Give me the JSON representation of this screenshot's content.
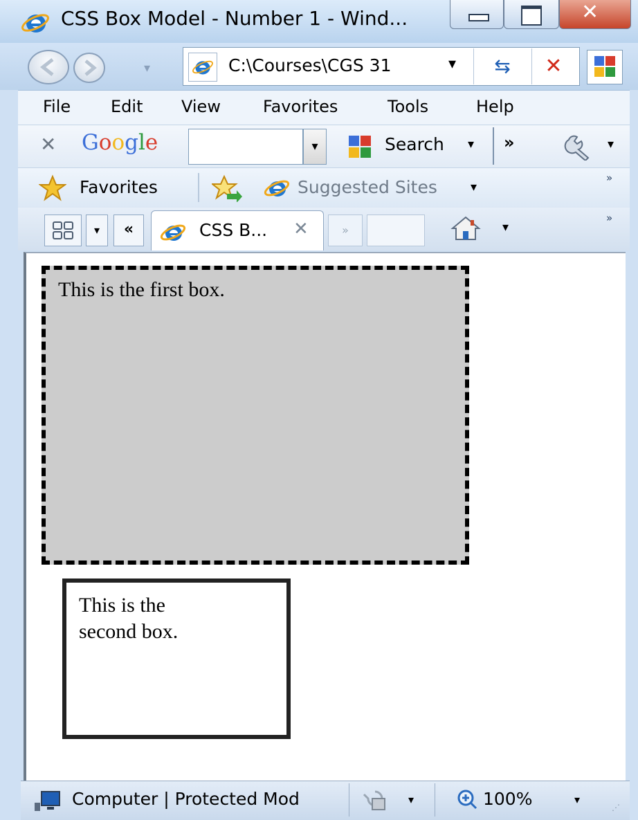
{
  "window": {
    "title": "CSS Box Model - Number 1 - Wind...",
    "close_glyph": "✕"
  },
  "nav": {
    "address": "C:\\Courses\\CGS 31",
    "dropdown_glyph": "▾",
    "refresh_glyph": "⇆",
    "stop_glyph": "✕"
  },
  "menu": {
    "items": [
      "File",
      "Edit",
      "View",
      "Favorites",
      "Tools",
      "Help"
    ]
  },
  "google_toolbar": {
    "close_glyph": "✕",
    "logo_letters": [
      "G",
      "o",
      "o",
      "g",
      "l",
      "e"
    ],
    "search_value": "",
    "search_label": "Search",
    "more_glyph": "»",
    "dd_glyph": "▾"
  },
  "favorites_bar": {
    "favorites_label": "Favorites",
    "suggested_sites_label": "Suggested Sites",
    "overflow_glyph": "»"
  },
  "tabs": {
    "scroll_left_glyph": "«",
    "scroll_right_glyph": "»",
    "active_tab_label": "CSS B...",
    "close_glyph": "✕",
    "overflow_glyph": "»"
  },
  "page": {
    "box1_text": "This is the first box.",
    "box2_text": "This is the second box."
  },
  "status": {
    "zone_text": "Computer | Protected Mod",
    "zoom": "100%"
  },
  "colors": {
    "box1_background": "#cccccc",
    "box_border": "#000000",
    "chrome_blue": "#cfe0f3",
    "stop_red": "#d12a1a"
  }
}
